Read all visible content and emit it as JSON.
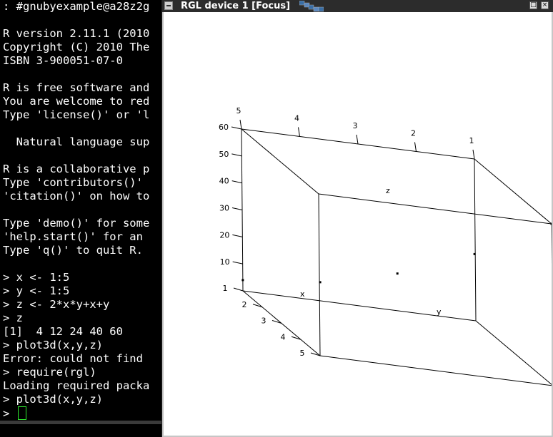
{
  "terminal": {
    "lines": [
      ": #gnubyexample@a28z2g",
      "",
      "R version 2.11.1 (2010",
      "Copyright (C) 2010 The",
      "ISBN 3-900051-07-0",
      "",
      "R is free software and",
      "You are welcome to red",
      "Type 'license()' or 'l",
      "",
      "  Natural language sup",
      "",
      "R is a collaborative p",
      "Type 'contributors()'",
      "'citation()' on how to",
      "",
      "Type 'demo()' for some",
      "'help.start()' for an",
      "Type 'q()' to quit R.",
      "",
      "> x <- 1:5",
      "> y <- 1:5",
      "> z <- 2*x*y+x+y",
      "> z",
      "[1]  4 12 24 40 60",
      "> plot3d(x,y,z)",
      "Error: could not find",
      "> require(rgl)",
      "Loading required packa",
      "> plot3d(x,y,z)"
    ],
    "prompt": "> "
  },
  "rgl_window": {
    "title": "RGL device 1 [Focus]",
    "maximize_label": "□",
    "close_label": "×"
  },
  "chart_data": {
    "type": "scatter",
    "dimensions": 3,
    "x": [
      1,
      2,
      3,
      4,
      5
    ],
    "y": [
      1,
      2,
      3,
      4,
      5
    ],
    "z": [
      4,
      12,
      24,
      40,
      60
    ],
    "xlabel": "x",
    "ylabel": "y",
    "zlabel": "z",
    "x_ticks_front": [
      "1",
      "2",
      "3",
      "4",
      "5"
    ],
    "x_ticks_back": [
      "5",
      "4",
      "3",
      "2",
      "1"
    ],
    "z_ticks": [
      "10",
      "20",
      "30",
      "40",
      "50",
      "60"
    ],
    "box": true,
    "colors": {
      "points": "#000000",
      "box": "#000000",
      "background": "#ffffff"
    }
  }
}
